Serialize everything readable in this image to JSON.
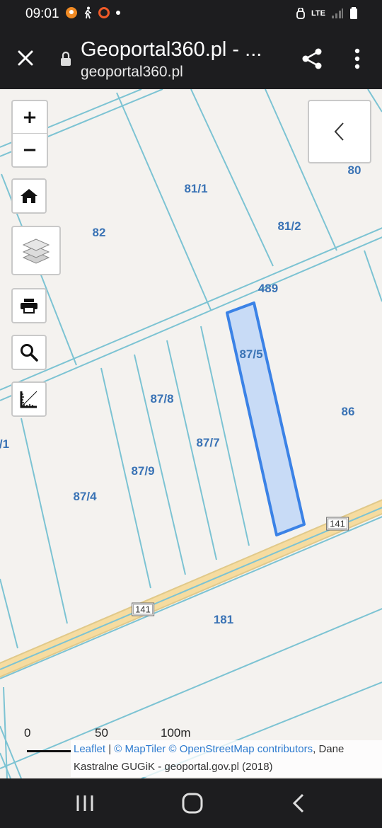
{
  "status_bar": {
    "time": "09:01",
    "network": "LTE",
    "icons": [
      "notification-icon",
      "walk-icon",
      "circle-icon",
      "dot-icon",
      "alarm-icon",
      "signal-icon",
      "battery-icon"
    ]
  },
  "app_bar": {
    "title": "Geoportal360.pl - ...",
    "url": "geoportal360.pl"
  },
  "map": {
    "parcels": [
      {
        "id": "p-81-1",
        "label": "81/1"
      },
      {
        "id": "p-81-2",
        "label": "81/2"
      },
      {
        "id": "p-80",
        "label": "80"
      },
      {
        "id": "p-82",
        "label": "82"
      },
      {
        "id": "p-489",
        "label": "489"
      },
      {
        "id": "p-87-5",
        "label": "87/5"
      },
      {
        "id": "p-87-8",
        "label": "87/8"
      },
      {
        "id": "p-86",
        "label": "86"
      },
      {
        "id": "p-1",
        "label": "/1"
      },
      {
        "id": "p-87-7",
        "label": "87/7"
      },
      {
        "id": "p-87-9",
        "label": "87/9"
      },
      {
        "id": "p-87-4",
        "label": "87/4"
      },
      {
        "id": "p-181",
        "label": "181"
      }
    ],
    "road_shields": [
      "141",
      "141"
    ],
    "selected_parcel": "87/5",
    "colors": {
      "boundary": "#7cc3d3",
      "label": "#3a73b5",
      "selection_stroke": "#3b82e6",
      "selection_fill": "#c8dbf6",
      "road": "#f6dca0"
    }
  },
  "controls": {
    "zoom_in": "+",
    "zoom_out": "−",
    "home": "home-icon",
    "layers": "layers-icon",
    "print": "print-icon",
    "search": "search-icon",
    "measure": "measure-icon",
    "collapse": "chevron-left-icon"
  },
  "scale": {
    "labels": [
      "0",
      "50",
      "100m"
    ]
  },
  "attribution": {
    "leaflet": "Leaflet",
    "separator": "|",
    "maptiler": "© MapTiler",
    "osm": "© OpenStreetMap contributors",
    "rest": ", Dane Kastralne GUGiK - geoportal.gov.pl (2018)"
  }
}
